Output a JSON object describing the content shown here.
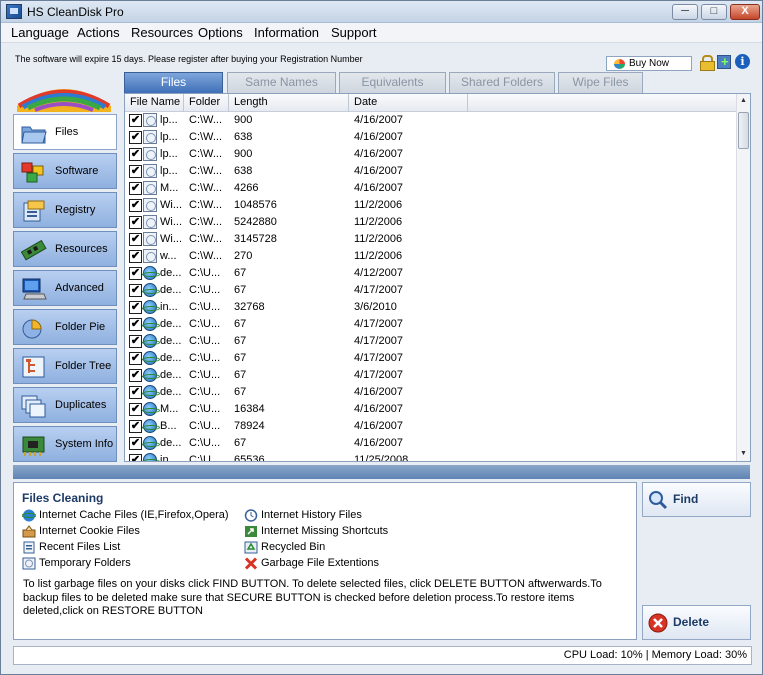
{
  "window": {
    "title": "HS CleanDisk Pro",
    "minimize_label": "─",
    "maximize_label": "□",
    "close_label": "X"
  },
  "menu": [
    "Language",
    "Actions",
    "Resources",
    "Options",
    "Information",
    "Support"
  ],
  "notice": "The software will expire 15 days. Please register after buying your Registration Number",
  "buy_now": "Buy Now",
  "sidebar": [
    {
      "label": "Files",
      "icon": "folder-icon",
      "active": true
    },
    {
      "label": "Software",
      "icon": "cubes-icon",
      "active": false
    },
    {
      "label": "Registry",
      "icon": "registry-icon",
      "active": false
    },
    {
      "label": "Resources",
      "icon": "memory-chip-icon",
      "active": false
    },
    {
      "label": "Advanced",
      "icon": "computer-icon",
      "active": false
    },
    {
      "label": "Folder Pie",
      "icon": "pie-chart-icon",
      "active": false
    },
    {
      "label": "Folder Tree",
      "icon": "folder-tree-icon",
      "active": false
    },
    {
      "label": "Duplicates",
      "icon": "duplicates-icon",
      "active": false
    },
    {
      "label": "System Info",
      "icon": "system-info-icon",
      "active": false
    }
  ],
  "tabs": [
    {
      "label": "Files",
      "active": true
    },
    {
      "label": "Same Names",
      "active": false
    },
    {
      "label": "Equivalents",
      "active": false
    },
    {
      "label": "Shared Folders",
      "active": false
    },
    {
      "label": "Wipe Files",
      "active": false
    }
  ],
  "table": {
    "columns": [
      "File Name",
      "Folder",
      "Length",
      "Date"
    ],
    "check_mark": "✔",
    "rows": [
      {
        "name": "lp...",
        "folder": "C:\\W...",
        "length": "900",
        "date": "4/16/2007",
        "icon": "doc"
      },
      {
        "name": "lp...",
        "folder": "C:\\W...",
        "length": "638",
        "date": "4/16/2007",
        "icon": "doc"
      },
      {
        "name": "lp...",
        "folder": "C:\\W...",
        "length": "900",
        "date": "4/16/2007",
        "icon": "doc"
      },
      {
        "name": "lp...",
        "folder": "C:\\W...",
        "length": "638",
        "date": "4/16/2007",
        "icon": "doc"
      },
      {
        "name": "M...",
        "folder": "C:\\W...",
        "length": "4266",
        "date": "4/16/2007",
        "icon": "doc"
      },
      {
        "name": "Wi...",
        "folder": "C:\\W...",
        "length": "1048576",
        "date": "11/2/2006",
        "icon": "doc"
      },
      {
        "name": "Wi...",
        "folder": "C:\\W...",
        "length": "5242880",
        "date": "11/2/2006",
        "icon": "doc"
      },
      {
        "name": "Wi...",
        "folder": "C:\\W...",
        "length": "3145728",
        "date": "11/2/2006",
        "icon": "doc"
      },
      {
        "name": "w...",
        "folder": "C:\\W...",
        "length": "270",
        "date": "11/2/2006",
        "icon": "doc"
      },
      {
        "name": "de...",
        "folder": "C:\\U...",
        "length": "67",
        "date": "4/12/2007",
        "icon": "ie"
      },
      {
        "name": "de...",
        "folder": "C:\\U...",
        "length": "67",
        "date": "4/17/2007",
        "icon": "ie"
      },
      {
        "name": "in...",
        "folder": "C:\\U...",
        "length": "32768",
        "date": "3/6/2010",
        "icon": "ie"
      },
      {
        "name": "de...",
        "folder": "C:\\U...",
        "length": "67",
        "date": "4/17/2007",
        "icon": "ie"
      },
      {
        "name": "de...",
        "folder": "C:\\U...",
        "length": "67",
        "date": "4/17/2007",
        "icon": "ie"
      },
      {
        "name": "de...",
        "folder": "C:\\U...",
        "length": "67",
        "date": "4/17/2007",
        "icon": "ie"
      },
      {
        "name": "de...",
        "folder": "C:\\U...",
        "length": "67",
        "date": "4/17/2007",
        "icon": "ie"
      },
      {
        "name": "de...",
        "folder": "C:\\U...",
        "length": "67",
        "date": "4/16/2007",
        "icon": "ie"
      },
      {
        "name": "M...",
        "folder": "C:\\U...",
        "length": "16384",
        "date": "4/16/2007",
        "icon": "ie"
      },
      {
        "name": "B...",
        "folder": "C:\\U...",
        "length": "78924",
        "date": "4/16/2007",
        "icon": "ie"
      },
      {
        "name": "de...",
        "folder": "C:\\U...",
        "length": "67",
        "date": "4/16/2007",
        "icon": "ie"
      },
      {
        "name": "in...",
        "folder": "C:\\U...",
        "length": "65536",
        "date": "11/25/2008",
        "icon": "ie"
      }
    ]
  },
  "cleaning": {
    "title": "Files Cleaning",
    "categories": [
      {
        "label": "Internet Cache Files (IE,Firefox,Opera)",
        "icon": "ie-icon"
      },
      {
        "label": "Internet Cookie Files",
        "icon": "cookie-icon"
      },
      {
        "label": "Recent Files List",
        "icon": "recent-files-icon"
      },
      {
        "label": "Temporary Folders",
        "icon": "temp-folder-icon"
      },
      {
        "label": "Internet History Files",
        "icon": "history-clock-icon"
      },
      {
        "label": "Internet Missing Shortcuts",
        "icon": "shortcut-icon"
      },
      {
        "label": "Recycled Bin",
        "icon": "recycle-bin-icon"
      },
      {
        "label": "Garbage File Extentions",
        "icon": "red-x-icon"
      }
    ],
    "description": "To list garbage files on your disks click FIND BUTTON. To delete selected files, click DELETE BUTTON aftwerwards.To backup files to be deleted make sure that SECURE BUTTON is checked before deletion process.To restore items deleted,click on RESTORE BUTTON"
  },
  "buttons": {
    "find": "Find",
    "delete": "Delete"
  },
  "status": "CPU Load: 10%  |  Memory Load: 30%",
  "colors": {
    "accent": "#3e6fb7",
    "sidebar": "#8fb0df",
    "delete_icon": "#d83324"
  }
}
